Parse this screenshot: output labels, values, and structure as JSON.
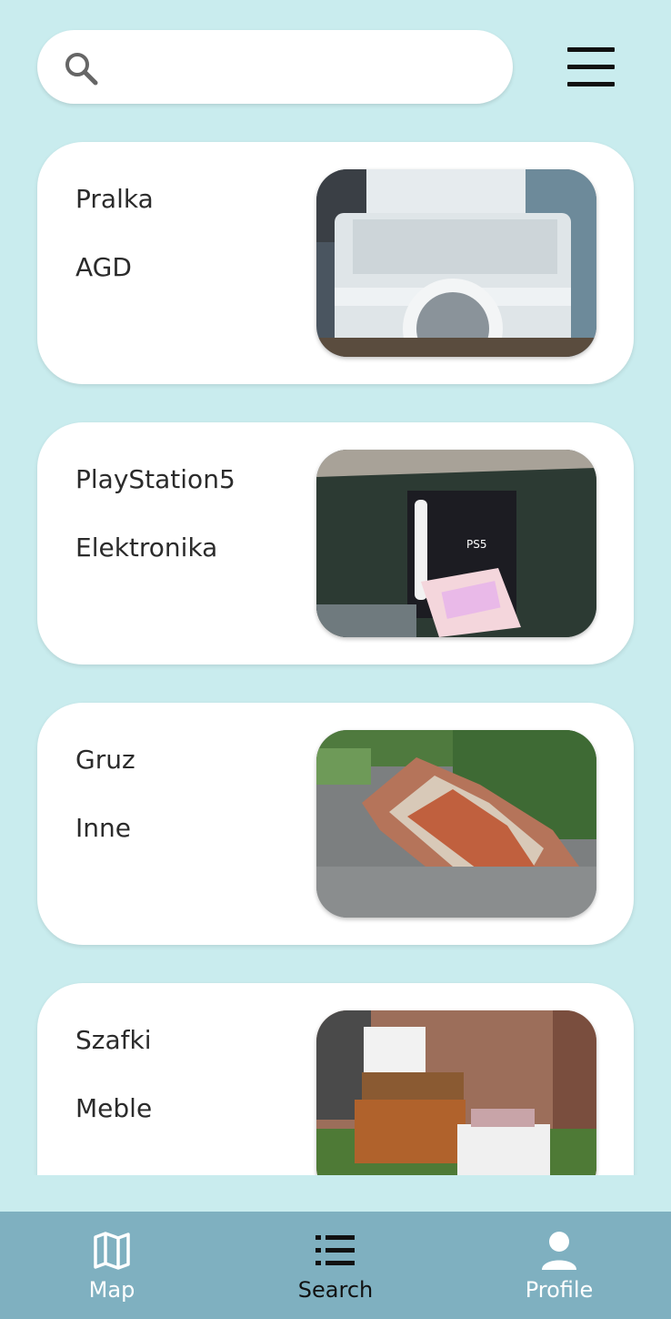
{
  "search": {
    "placeholder": "",
    "value": ""
  },
  "menu": {
    "icon": "hamburger-menu-icon"
  },
  "items": [
    {
      "title": "Pralka",
      "category": "AGD",
      "image": "washing-machine-photo"
    },
    {
      "title": "PlayStation5",
      "category": "Elektronika",
      "image": "ps5-box-photo"
    },
    {
      "title": "Gruz",
      "category": "Inne",
      "image": "rubble-pile-photo"
    },
    {
      "title": "Szafki",
      "category": "Meble",
      "image": "cabinets-photo"
    }
  ],
  "nav": [
    {
      "label": "Map",
      "icon": "map-icon",
      "active": false
    },
    {
      "label": "Search",
      "icon": "list-icon",
      "active": true
    },
    {
      "label": "Profile",
      "icon": "person-icon",
      "active": false
    }
  ],
  "colors": {
    "background": "#c9ecee",
    "card": "#ffffff",
    "bottom_nav": "#7fb0c0",
    "nav_active_text": "#111111",
    "nav_inactive_text": "#ffffff"
  }
}
